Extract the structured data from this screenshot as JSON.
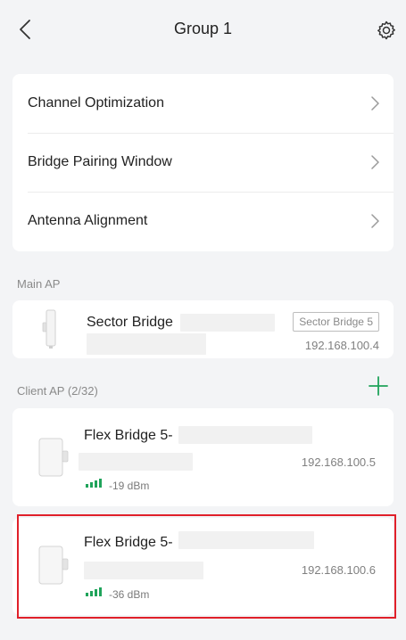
{
  "header": {
    "title": "Group 1",
    "back_icon": "chevron-left-icon",
    "settings_icon": "gear-icon"
  },
  "menu": {
    "items": [
      {
        "label": "Channel Optimization"
      },
      {
        "label": "Bridge Pairing Window"
      },
      {
        "label": "Antenna Alignment"
      }
    ]
  },
  "main_ap": {
    "section_label": "Main AP",
    "device": {
      "name": "Sector Bridge",
      "model_tag": "Sector Bridge 5",
      "ip": "192.168.100.4"
    }
  },
  "client_ap": {
    "section_label": "Client AP (2/32)",
    "add_icon": "plus-icon",
    "devices": [
      {
        "name": "Flex Bridge 5-",
        "ip": "192.168.100.5",
        "signal": "-19 dBm"
      },
      {
        "name": "Flex Bridge 5-",
        "ip": "192.168.100.6",
        "signal": "-36 dBm"
      }
    ]
  },
  "colors": {
    "background": "#f3f4f6",
    "card": "#ffffff",
    "accent_green": "#1fa35a",
    "highlight_red": "#e0202a"
  }
}
